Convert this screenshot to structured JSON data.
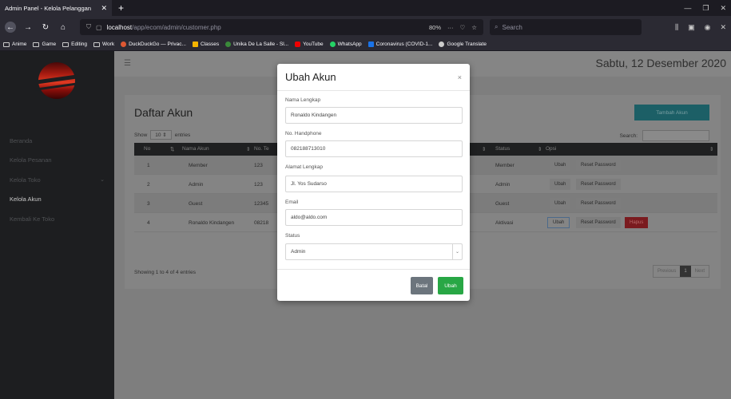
{
  "browser": {
    "tab_title": "Admin Panel - Kelola Pelanggan",
    "url_host": "localhost",
    "url_path": "/app/ecom/admin/customer.php",
    "zoom": "80%",
    "search_placeholder": "Search",
    "bookmarks": [
      "Anime",
      "Game",
      "Editing",
      "Work",
      "DuckDuckGo — Privac...",
      "Classes",
      "Unika De La Salle - Sl...",
      "YouTube",
      "WhatsApp",
      "Coronavirus (COVID-1...",
      "Google Translate"
    ]
  },
  "sidebar": {
    "items": [
      {
        "label": "Beranda"
      },
      {
        "label": "Kelola Pesanan"
      },
      {
        "label": "Kelola Toko"
      },
      {
        "label": "Kelola Akun"
      },
      {
        "label": "Kembali Ke Toko"
      }
    ]
  },
  "header": {
    "date": "Sabtu, 12 Desember 2020"
  },
  "main": {
    "title": "Daftar Akun",
    "add_button": "Tambah Akun",
    "show_label": "Show",
    "show_value": "10",
    "entries_label": "entries",
    "search_label": "Search:",
    "columns": [
      "No",
      "Nama Akun",
      "No. Te",
      "Status",
      "Opsi"
    ],
    "rows": [
      {
        "no": "1",
        "name": "Member",
        "phone": "123",
        "status": "Member"
      },
      {
        "no": "2",
        "name": "Admin",
        "phone": "123",
        "status": "Admin"
      },
      {
        "no": "3",
        "name": "Guest",
        "phone": "12345",
        "status": "Guest"
      },
      {
        "no": "4",
        "name": "Ronaldo Kindangen",
        "phone": "08218",
        "status": "Aktivasi"
      }
    ],
    "edit_label": "Ubah",
    "reset_label": "Reset Password",
    "delete_label": "Hapus",
    "showing": "Showing 1 to 4 of 4 entries",
    "pager": {
      "prev": "Previous",
      "page": "1",
      "next": "Next"
    }
  },
  "modal": {
    "title": "Ubah Akun",
    "close": "×",
    "fields": [
      {
        "label": "Nama Lengkap",
        "value": "Ronaldo Kindangen"
      },
      {
        "label": "No. Handphone",
        "value": "082188713010"
      },
      {
        "label": "Alamat Lengkap",
        "value": "Jl. Yos Sudarso"
      },
      {
        "label": "Email",
        "value": "aldo@aldo.com"
      },
      {
        "label": "Status",
        "value": "Admin"
      }
    ],
    "cancel": "Batal",
    "submit": "Ubah"
  }
}
